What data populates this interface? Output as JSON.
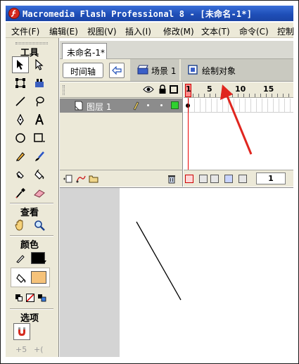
{
  "window": {
    "title": "Macromedia Flash Professional 8 - [未命名-1*]"
  },
  "menu": {
    "items": [
      {
        "label": "文件(F)"
      },
      {
        "label": "编辑(E)"
      },
      {
        "label": "视图(V)"
      },
      {
        "label": "插入(I)"
      },
      {
        "label": "修改(M)"
      },
      {
        "label": "文本(T)"
      },
      {
        "label": "命令(C)"
      },
      {
        "label": "控制"
      }
    ]
  },
  "tools": {
    "tools_title": "工具",
    "view_title": "查看",
    "color_title": "颜色",
    "options_title": "选项",
    "stroke_color": "#000000",
    "fill_color": "#f5c27a"
  },
  "document": {
    "tab_label": "未命名-1*",
    "timeline_button": "时间轴",
    "scene_label": "场景 1",
    "drawing_object_label": "绘制对象"
  },
  "timeline": {
    "layer_name": "图层 1",
    "layer_color": "#2fd12f",
    "current_frame": "1",
    "ruler_labels": [
      "1",
      "5",
      "10",
      "15"
    ],
    "frame_field": "1"
  },
  "colors": {
    "annotation_arrow": "#e0261f",
    "title_bar": "#1f4fb8"
  }
}
